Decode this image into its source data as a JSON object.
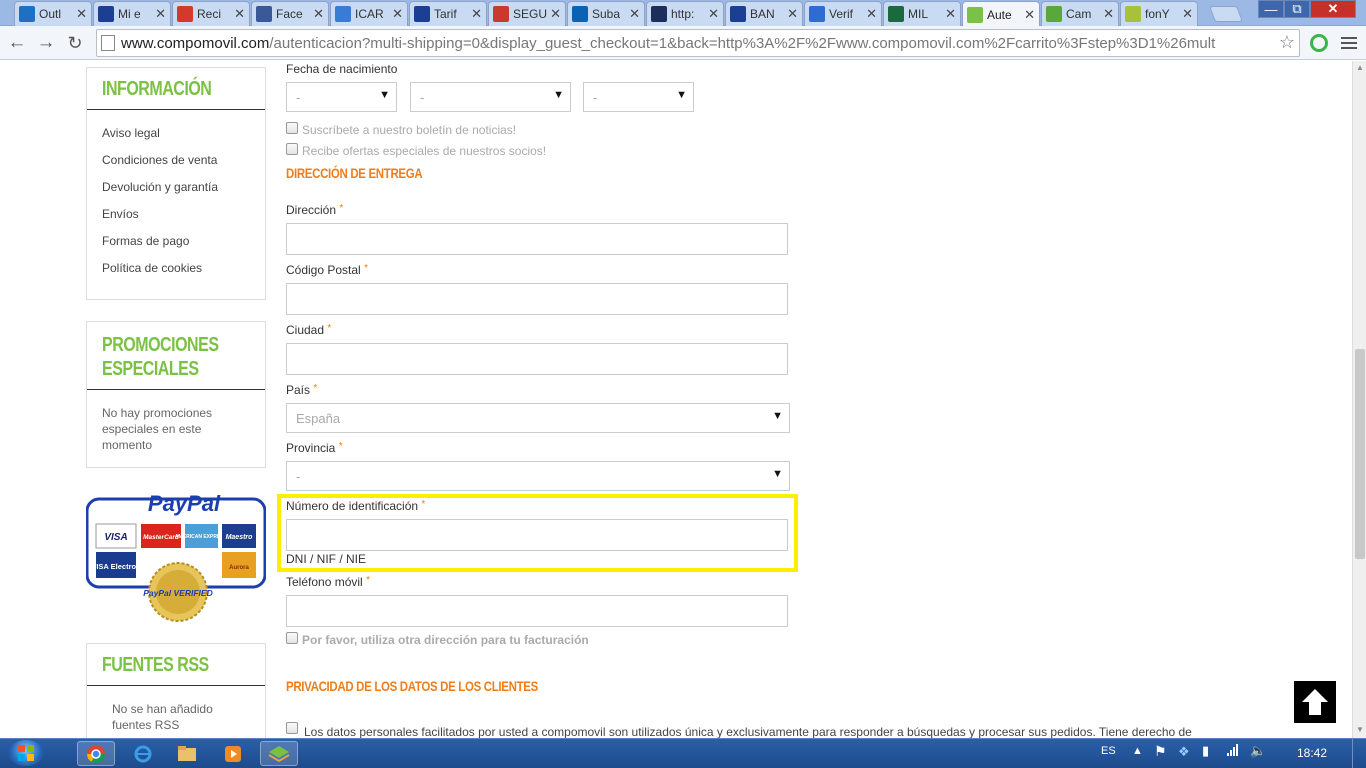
{
  "browser": {
    "tabs": [
      {
        "label": "Outl",
        "favicon": "outlook-icon",
        "color": "#1f6fc5"
      },
      {
        "label": "Mi e",
        "favicon": "store-icon",
        "color": "#1c3f94"
      },
      {
        "label": "Reci",
        "favicon": "gmail-icon",
        "color": "#d33a2c"
      },
      {
        "label": "Face",
        "favicon": "facebook-icon",
        "color": "#3b5998"
      },
      {
        "label": "ICAR",
        "favicon": "bird-icon",
        "color": "#3a7bd5"
      },
      {
        "label": "Tarif",
        "favicon": "store-icon",
        "color": "#1c3f94"
      },
      {
        "label": "SEGU",
        "favicon": "box-icon",
        "color": "#c9392c"
      },
      {
        "label": "Suba",
        "favicon": "sj-icon",
        "color": "#0a62b5"
      },
      {
        "label": "http:",
        "favicon": "abc-icon",
        "color": "#1c2e5a"
      },
      {
        "label": "BAN",
        "favicon": "store-icon",
        "color": "#1c3f94"
      },
      {
        "label": "Verif",
        "favicon": "verify-icon",
        "color": "#2f6bd0"
      },
      {
        "label": "MIL",
        "favicon": "mil-icon",
        "color": "#1b6a3d"
      },
      {
        "label": "Aute",
        "favicon": "compomovil-icon",
        "color": "#7bc143"
      },
      {
        "label": "Cam",
        "favicon": "android-icon",
        "color": "#5aa83b"
      },
      {
        "label": "fonY",
        "favicon": "fonyou-icon",
        "color": "#a7c23a"
      }
    ],
    "url_host": "www.compomovil.com",
    "url_path": "/autenticacion?multi-shipping=0&display_guest_checkout=1&back=http%3A%2F%2Fwww.compomovil.com%2Fcarrito%3Fstep%3D1%26mult"
  },
  "sidebar": {
    "info_title": "INFORMACIÓN",
    "info_links": [
      "Aviso legal",
      "Condiciones de venta",
      "Devolución y garantía",
      "Envíos",
      "Formas de pago",
      "Política de cookies"
    ],
    "promo_title": "PROMOCIONES ESPECIALES",
    "promo_text": "No hay promociones especiales en este momento",
    "paypal": {
      "brand": "PayPal",
      "verified": "PayPal VERIFIED",
      "cards": [
        "VISA",
        "MasterCard",
        "AMERICAN EXPRESS",
        "Maestro",
        "VISA Electron",
        "Aurora"
      ]
    },
    "rss_title": "FUENTES RSS",
    "rss_text": "No se han añadido fuentes RSS"
  },
  "form": {
    "birth_label": "Fecha de nacimiento",
    "birth_day": "-",
    "birth_month": "-",
    "birth_year": "-",
    "newsletter": "Suscríbete a nuestro boletín de noticias!",
    "offers": "Recibe ofertas especiales de nuestros socios!",
    "delivery_title": "DIRECCIÓN DE ENTREGA",
    "address_label": "Dirección",
    "address_value": "",
    "postcode_label": "Código Postal",
    "postcode_value": "",
    "city_label": "Ciudad",
    "city_value": "",
    "country_label": "País",
    "country_value": "España",
    "province_label": "Provincia",
    "province_value": "-",
    "id_label": "Número de identificación",
    "id_value": "",
    "id_hint": "DNI / NIF / NIE",
    "mobile_label": "Teléfono móvil",
    "mobile_value": "",
    "other_address": "Por favor, utiliza otra dirección para tu facturación",
    "privacy_title": "PRIVACIDAD DE LOS DATOS DE LOS CLIENTES",
    "privacy_text": "Los datos personales facilitados por usted a compomovil son utilizados única y exclusivamente para responder a búsquedas y procesar sus pedidos. Tiene derecho de",
    "required_mark": "*"
  },
  "taskbar": {
    "lang": "ES",
    "time": "18:42"
  },
  "colors": {
    "accent_green": "#7bc143",
    "accent_orange": "#f07d1a",
    "highlight": "#f8f000"
  }
}
